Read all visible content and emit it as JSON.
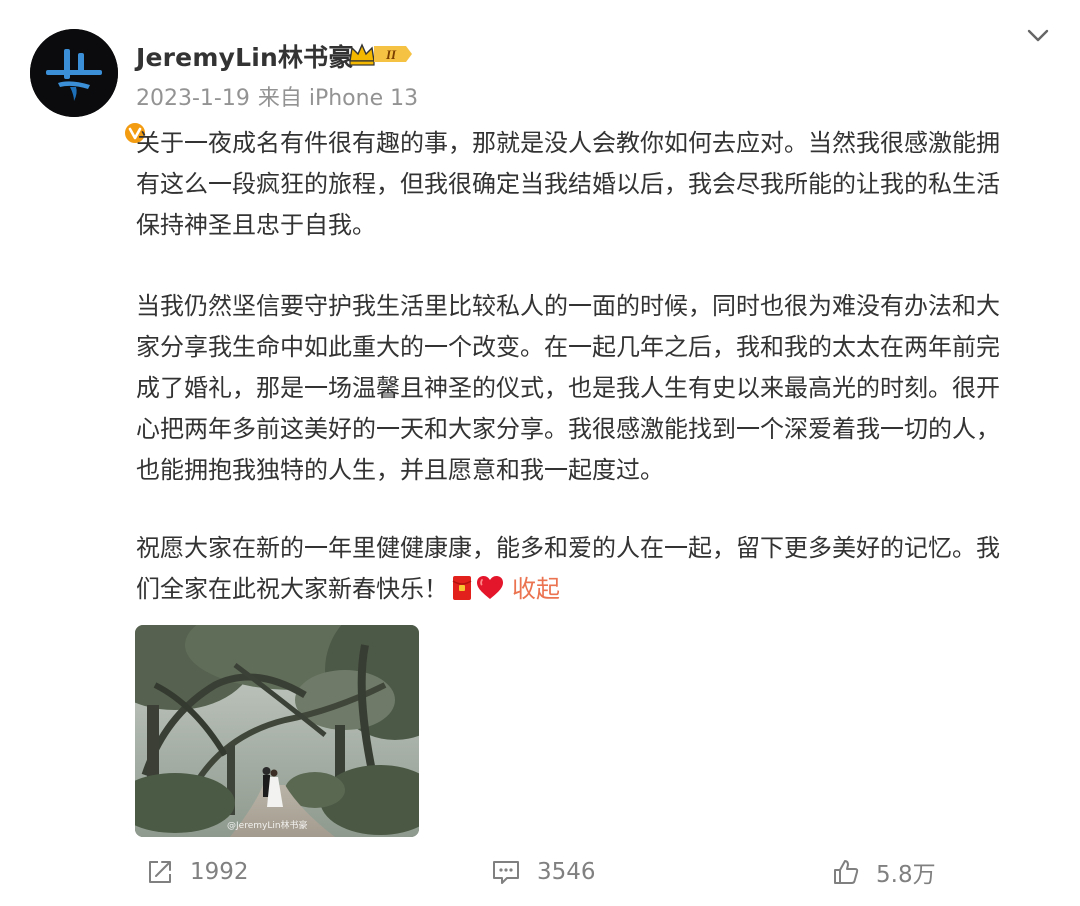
{
  "post": {
    "author": "JeremyLin林书豪",
    "date": "2023-1-19",
    "source": "来自 iPhone 13",
    "paragraphs": [
      [
        "关于一夜成名有件很有趣的事，那就是没人会教你如何去应对。当然我很感激能拥",
        "有这么一段疯狂的旅程，但我很确定当我结婚以后，我会尽我所能的让我的私生活",
        "保持神圣且忠于自我。"
      ],
      [
        "当我仍然坚信要守护我生活里比较私人的一面的时候，同时也很为难没有办法和大",
        "家分享我生命中如此重大的一个改变。在一起几年之后，我和我的太太在两年前完",
        "成了婚礼，那是一场温馨且神圣的仪式，也是我人生有史以来最高光的时刻。很开",
        "心把两年多前这美好的一天和大家分享。我很感激能找到一个深爱着我一切的人，",
        "也能拥抱我独特的人生，并且愿意和我一起度过。"
      ],
      [
        "祝愿大家在新的一年里健健康康，能多和爱的人在一起，留下更多美好的记忆。我",
        "们全家在此祝大家新春快乐！"
      ]
    ],
    "collapse_label": "收起",
    "image_watermark": "@JeremyLin林书豪",
    "vip_level": "II",
    "icons": {
      "verified": "verified-badge-icon",
      "more": "chevron-down-icon",
      "envelope": "red-envelope-emoji-icon",
      "heart": "red-heart-emoji-icon"
    },
    "colors": {
      "accent": "#eb7350",
      "text": "#333333",
      "meta": "#939393",
      "action": "#808080",
      "verified": "#f39c12"
    }
  },
  "actions": {
    "share_count": "1992",
    "comment_count": "3546",
    "like_count": "5.8万"
  }
}
